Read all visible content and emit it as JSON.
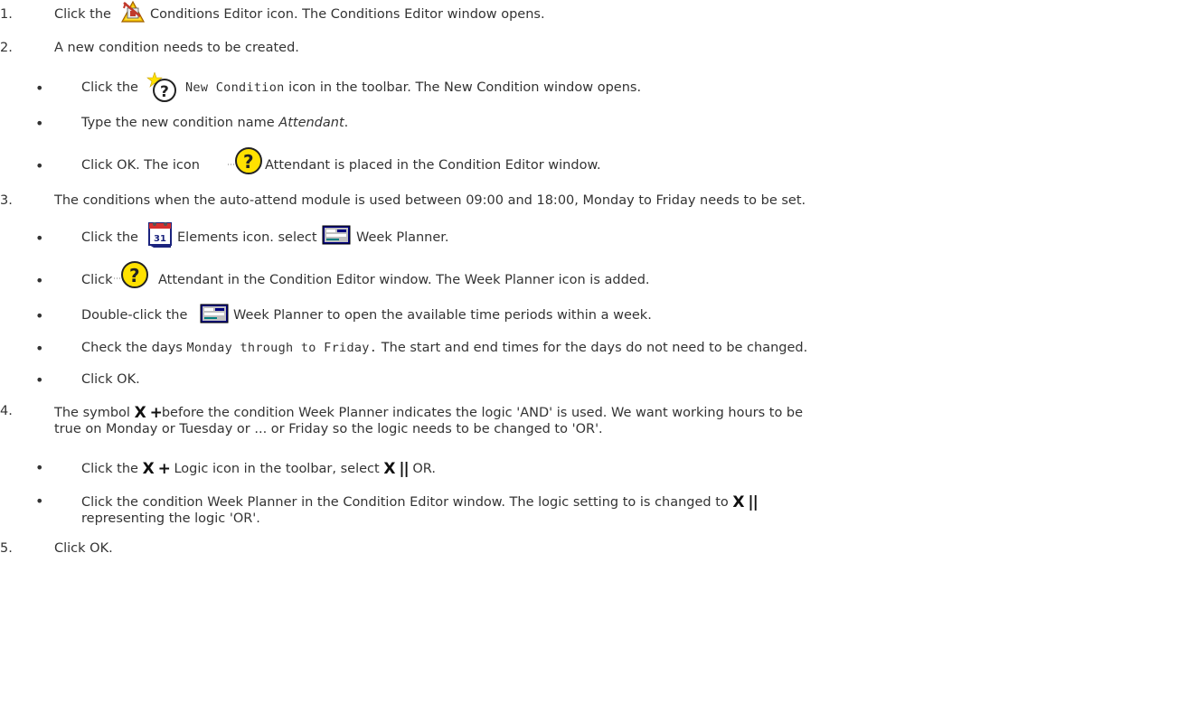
{
  "steps": {
    "s1": {
      "num": "1.",
      "pre": "Click the",
      "post": "Conditions Editor icon. The Conditions Editor window opens.",
      "icon": "conditions-editor-icon"
    },
    "s2": {
      "num": "2.",
      "text": "A new condition needs to be created.",
      "b1_pre": "Click the",
      "b1_mid": "New Condition",
      "b1_post": "icon in the toolbar. The New Condition window opens.",
      "b2_pre": "Type the new condition name",
      "b2_em": "Attendant",
      "b2_post": ".",
      "b3_pre": "Click OK. The icon",
      "b3_post": "Attendant is placed in the Condition Editor window."
    },
    "s3": {
      "num": "3.",
      "text": "The conditions when the auto-attend module is used between 09:00 and 18:00, Monday to Friday needs to be set.",
      "b1_pre": "Click the",
      "b1_mid": "Elements icon. select",
      "b1_post": "Week Planner.",
      "b2_pre": "Click",
      "b2_post": "Attendant in the Condition Editor window. The Week Planner icon is added.",
      "b3_pre": "Double-click the",
      "b3_post": "Week Planner to open the available time periods within a week.",
      "b4_pre": "Check the days",
      "b4_mid": "Monday through to Friday.",
      "b4_post": "The start and end times for the days do not need to be changed.",
      "b5": "Click OK."
    },
    "s4": {
      "num": "4.",
      "pre": "The symbol",
      "and_symbol": "X +",
      "post": "before the condition Week Planner indicates the logic 'AND' is used. We want working hours to be",
      "line2": "true on Monday or Tuesday or ... or Friday so the logic needs to be changed to 'OR'.",
      "b1_pre": "Click the",
      "b1_mid": "Logic icon in the toolbar, select",
      "b1_post": "OR.",
      "or_symbol": "X ||",
      "b2_line1": "Click the condition Week Planner in the Condition Editor window. The logic setting to is changed to",
      "b2_line2": "representing the logic 'OR'."
    },
    "s5": {
      "num": "5.",
      "text": "Click OK."
    }
  },
  "bullet_char": "•"
}
